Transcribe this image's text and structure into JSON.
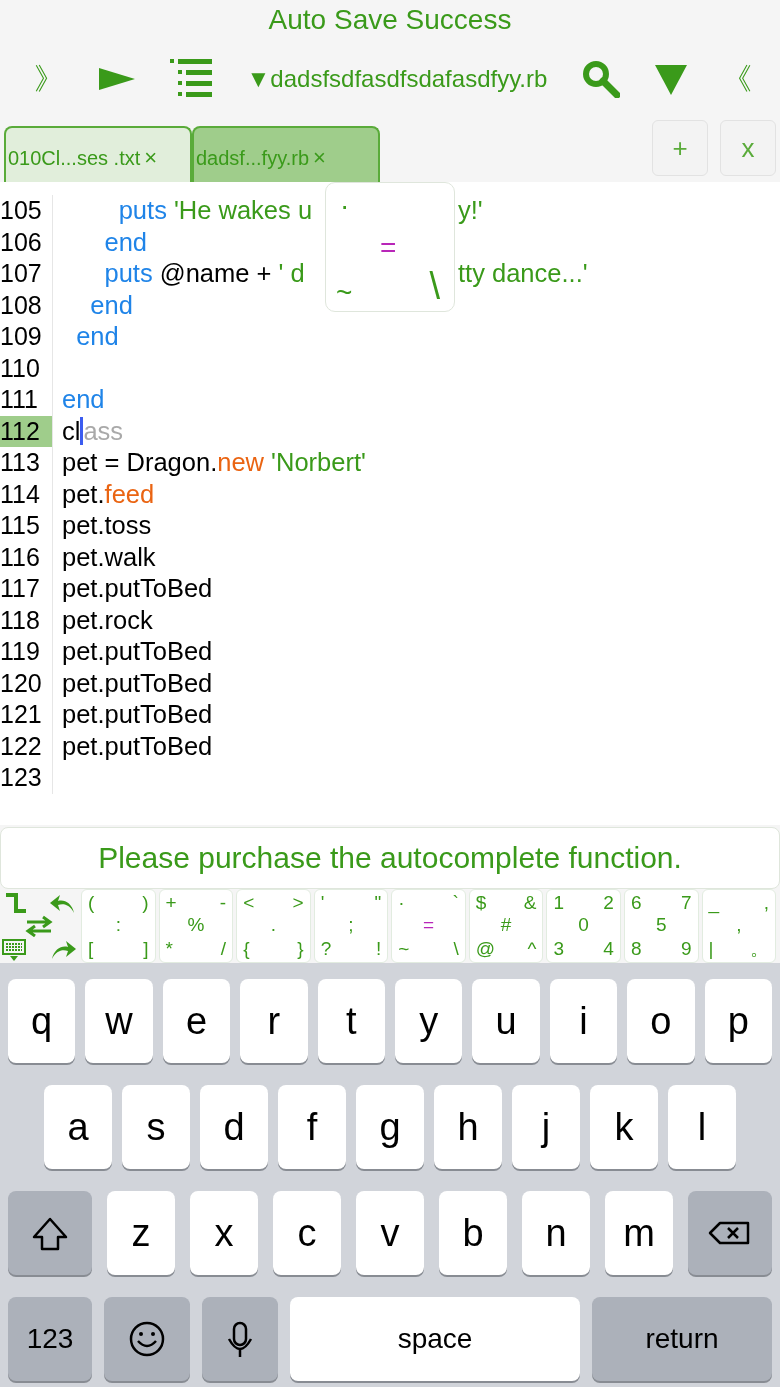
{
  "title": "Auto Save Success",
  "toolbar": {
    "left_glyph": "》",
    "file_menu": "▼dadsfsdfasdfsdafasdfyy.rb",
    "right_glyph": "《"
  },
  "tabs": [
    {
      "label": "010Cl...ses .txt",
      "close": "×",
      "selected": false
    },
    {
      "label": "dadsf...fyy.rb",
      "close": "×",
      "selected": true
    }
  ],
  "tab_actions": [
    "+",
    "x"
  ],
  "code_lines": [
    {
      "n": "105",
      "current": false,
      "tokens": [
        {
          "kind": "kw",
          "text": "        puts"
        },
        {
          "kind": "str",
          "text": " 'He wakes u"
        },
        {
          "kind": "gap"
        },
        {
          "kind": "str",
          "text": "y!'"
        }
      ]
    },
    {
      "n": "106",
      "current": false,
      "tokens": [
        {
          "kind": "kw",
          "text": "      end"
        }
      ]
    },
    {
      "n": "107",
      "current": false,
      "tokens": [
        {
          "kind": "kw",
          "text": "      puts"
        },
        {
          "kind": "plain",
          "text": " @name + "
        },
        {
          "kind": "str",
          "text": "' d"
        },
        {
          "kind": "gap"
        },
        {
          "kind": "str",
          "text": "tty dance...'"
        }
      ]
    },
    {
      "n": "108",
      "current": false,
      "tokens": [
        {
          "kind": "kw",
          "text": "    end"
        }
      ]
    },
    {
      "n": "109",
      "current": false,
      "tokens": [
        {
          "kind": "kw",
          "text": "  end"
        }
      ]
    },
    {
      "n": "110",
      "current": false
    },
    {
      "n": "111",
      "current": false,
      "tokens": [
        {
          "kind": "kw",
          "text": "end"
        }
      ]
    },
    {
      "n": "112",
      "current": true,
      "tokens": [
        {
          "kind": "plain",
          "text": "cl"
        },
        {
          "kind": "cursor"
        },
        {
          "kind": "ghost",
          "text": "ass"
        }
      ]
    },
    {
      "n": "113",
      "current": false,
      "tokens": [
        {
          "kind": "plain",
          "text": "pet = Dragon."
        },
        {
          "kind": "fn",
          "text": "new"
        },
        {
          "kind": "str",
          "text": " 'Norbert'"
        }
      ]
    },
    {
      "n": "114",
      "current": false,
      "tokens": [
        {
          "kind": "plain",
          "text": "pet."
        },
        {
          "kind": "fn",
          "text": "feed"
        }
      ]
    },
    {
      "n": "115",
      "current": false,
      "tokens": [
        {
          "kind": "plain",
          "text": "pet.toss"
        }
      ]
    },
    {
      "n": "116",
      "current": false,
      "tokens": [
        {
          "kind": "plain",
          "text": "pet.walk"
        }
      ]
    },
    {
      "n": "117",
      "current": false,
      "tokens": [
        {
          "kind": "plain",
          "text": "pet.putToBed"
        }
      ]
    },
    {
      "n": "118",
      "current": false,
      "tokens": [
        {
          "kind": "plain",
          "text": "pet.rock"
        }
      ]
    },
    {
      "n": "119",
      "current": false,
      "tokens": [
        {
          "kind": "plain",
          "text": "pet.putToBed"
        }
      ]
    },
    {
      "n": "120",
      "current": false,
      "tokens": [
        {
          "kind": "plain",
          "text": "pet.putToBed"
        }
      ]
    },
    {
      "n": "121",
      "current": false,
      "tokens": [
        {
          "kind": "plain",
          "text": "pet.putToBed"
        }
      ]
    },
    {
      "n": "122",
      "current": false,
      "tokens": [
        {
          "kind": "plain",
          "text": "pet.putToBed"
        }
      ]
    },
    {
      "n": "123",
      "current": false
    }
  ],
  "key_preview": {
    "tl": "·",
    "c": "=",
    "bl": "~",
    "br": "\\",
    "highlighted": true
  },
  "purchase_notice": "Please purchase the autocomplete function.",
  "symbol_keys": [
    {
      "tl": "(",
      "tr": ")",
      "c": ":",
      "bl": "[",
      "br": "]",
      "highlighted": false
    },
    {
      "tl": "+",
      "tr": "-",
      "c": "%",
      "bl": "*",
      "br": "/",
      "highlighted": false
    },
    {
      "tl": "<",
      "tr": ">",
      "c": ".",
      "bl": "{",
      "br": "}",
      "highlighted": false
    },
    {
      "tl": "'",
      "tr": "\"",
      "c": ";",
      "bl": "?",
      "br": "!",
      "highlighted": false
    },
    {
      "tl": "·",
      "tr": "`",
      "c": "=",
      "bl": "~",
      "br": "\\",
      "highlighted": true
    },
    {
      "tl": "$",
      "tr": "&",
      "c": "#",
      "bl": "@",
      "br": "^",
      "highlighted": false
    },
    {
      "tl": "1",
      "tr": "2",
      "c": "0",
      "bl": "3",
      "br": "4",
      "highlighted": false
    },
    {
      "tl": "6",
      "tr": "7",
      "c": "5",
      "bl": "8",
      "br": "9",
      "highlighted": false
    },
    {
      "tl": "_",
      "tr": ",",
      "c": ",",
      "bl": "|",
      "br": "。",
      "highlighted": false
    }
  ],
  "keyboard": {
    "rows": [
      {
        "keys": [
          {
            "label": "q"
          },
          {
            "label": "w"
          },
          {
            "label": "e"
          },
          {
            "label": "r"
          },
          {
            "label": "t"
          },
          {
            "label": "y"
          },
          {
            "label": "u"
          },
          {
            "label": "i"
          },
          {
            "label": "o"
          },
          {
            "label": "p"
          }
        ]
      },
      {
        "keys": [
          {
            "label": "a"
          },
          {
            "label": "s"
          },
          {
            "label": "d"
          },
          {
            "label": "f"
          },
          {
            "label": "g"
          },
          {
            "label": "h"
          },
          {
            "label": "j"
          },
          {
            "label": "k"
          },
          {
            "label": "l"
          }
        ]
      },
      {
        "keys": [
          {
            "label": "z"
          },
          {
            "label": "x"
          },
          {
            "label": "c"
          },
          {
            "label": "v"
          },
          {
            "label": "b"
          },
          {
            "label": "n"
          },
          {
            "label": "m"
          }
        ]
      }
    ],
    "numbers_key": "123",
    "space_key": "space",
    "return_key": "return"
  }
}
